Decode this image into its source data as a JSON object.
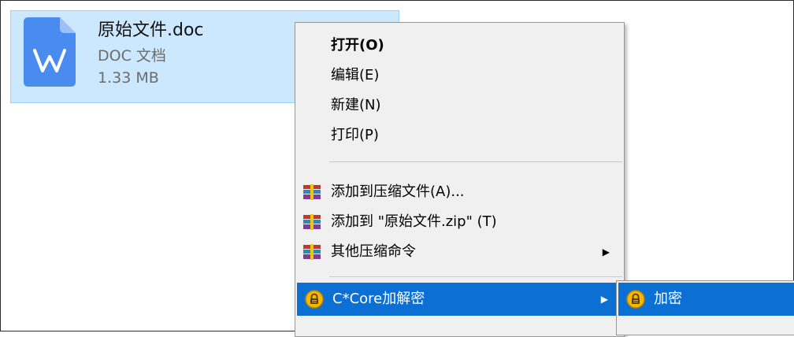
{
  "file": {
    "name": "原始文件.doc",
    "type": "DOC 文档",
    "size": "1.33 MB",
    "icon": "word-doc-icon",
    "accent": "#4a8bf0"
  },
  "context_menu": {
    "items": [
      {
        "label": "打开(O)",
        "bold": true
      },
      {
        "label": "编辑(E)"
      },
      {
        "label": "新建(N)"
      },
      {
        "label": "打印(P)"
      },
      {
        "label": "添加到压缩文件(A)...",
        "icon": "archive-icon"
      },
      {
        "label": "添加到 \"原始文件.zip\" (T)",
        "icon": "archive-icon"
      },
      {
        "label": "其他压缩命令",
        "icon": "archive-icon",
        "submenu": true
      },
      {
        "label": "C*Core加解密",
        "icon": "lock-icon",
        "submenu": true,
        "highlighted": true
      }
    ]
  },
  "submenu": {
    "items": [
      {
        "label": "加密",
        "icon": "lock-icon",
        "highlighted": true
      }
    ]
  },
  "colors": {
    "selection_bg": "#cce8ff",
    "menu_highlight": "#0b6fd4",
    "menu_bg": "#f0f0f0"
  }
}
